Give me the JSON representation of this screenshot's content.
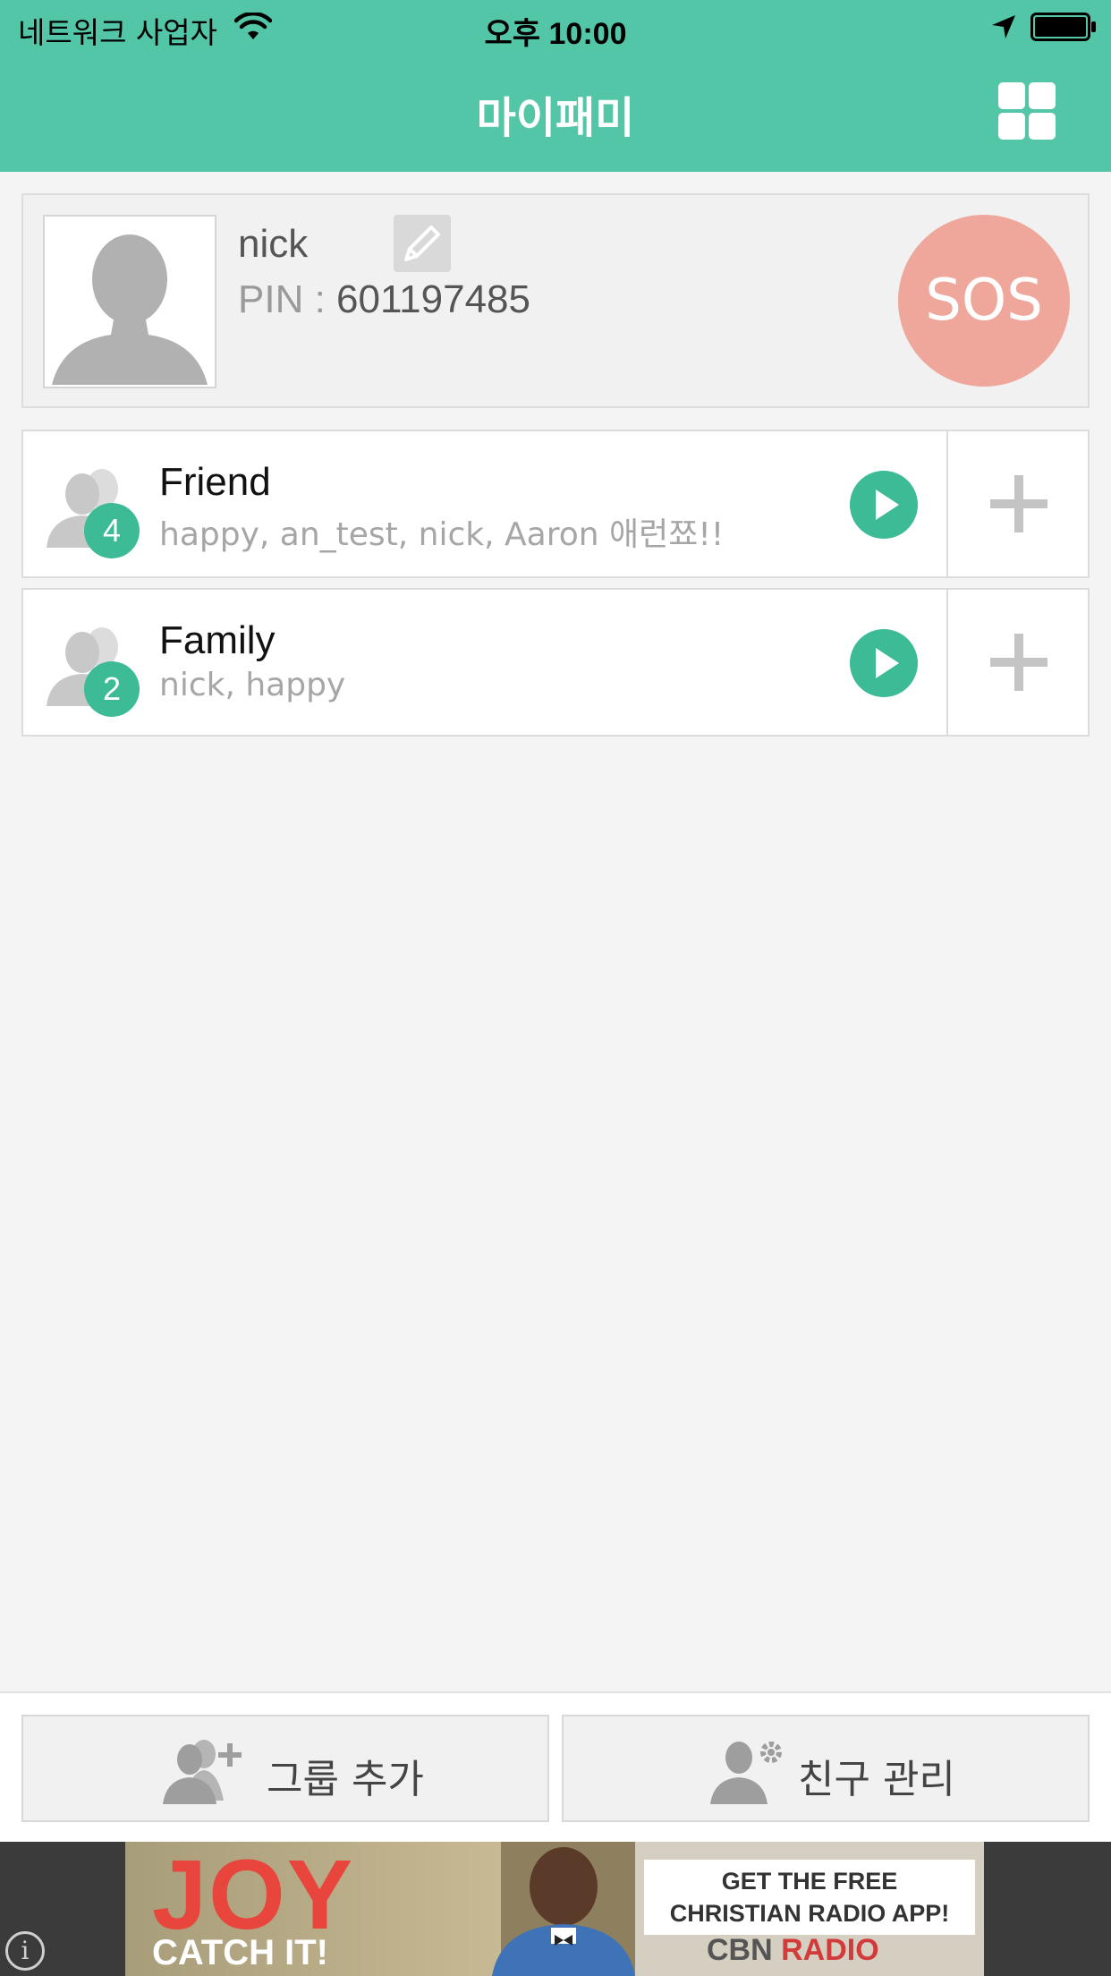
{
  "status_bar": {
    "carrier": "네트워크 사업자",
    "time": "오후 10:00"
  },
  "nav": {
    "title": "마이패미"
  },
  "profile": {
    "name": "nick",
    "pin_label": "PIN : ",
    "pin_value": "601197485",
    "sos_label": "SOS"
  },
  "groups": [
    {
      "name": "Friend",
      "count": "4",
      "members": "happy, an_test, nick, Aaron 애런쬬!!"
    },
    {
      "name": "Family",
      "count": "2",
      "members": "nick, happy"
    }
  ],
  "bottom_bar": {
    "add_group_label": "그룹 추가",
    "manage_friends_label": "친구 관리"
  },
  "ad": {
    "headline": "JOY",
    "subline": "CATCH IT!",
    "card_line1": "GET THE FREE",
    "card_line2": "CHRISTIAN RADIO APP!",
    "brand_prefix": "CBN",
    "brand_suffix": "RADIO",
    "info_icon": "i"
  },
  "colors": {
    "accent": "#53c6a7",
    "badge": "#3dbb96",
    "sos": "#efa79c"
  }
}
